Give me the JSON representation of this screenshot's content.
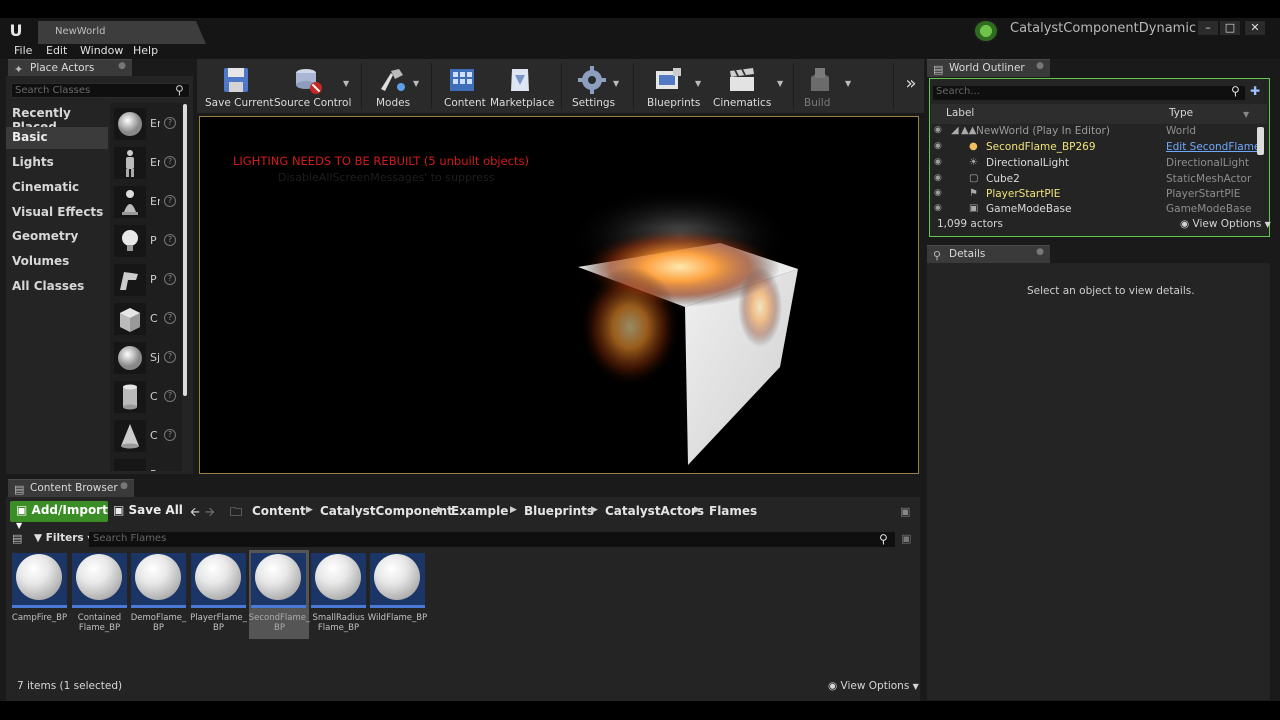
{
  "titlebar": {
    "level_tab": "NewWorld",
    "project_name": "CatalystComponentDynamic",
    "minimize": "–",
    "maximize": "□",
    "close": "✕"
  },
  "menu": [
    "File",
    "Edit",
    "Window",
    "Help"
  ],
  "place_actors": {
    "tab_label": "Place Actors",
    "search_placeholder": "Search Classes",
    "categories": [
      "Recently Placed",
      "Basic",
      "Lights",
      "Cinematic",
      "Visual Effects",
      "Geometry",
      "Volumes",
      "All Classes"
    ],
    "active_category": "Basic",
    "actors": [
      "Er",
      "Er",
      "Er",
      "P",
      "P",
      "C",
      "Sj",
      "C",
      "C",
      "P"
    ]
  },
  "toolbar": {
    "save_current": "Save Current",
    "source_control": "Source Control",
    "modes": "Modes",
    "content": "Content",
    "marketplace": "Marketplace",
    "settings": "Settings",
    "blueprints": "Blueprints",
    "cinematics": "Cinematics",
    "build": "Build",
    "more": "»"
  },
  "viewport": {
    "lighting_warning": "LIGHTING NEEDS TO BE REBUILT (5 unbuilt objects)",
    "suppress_hint": "DisableAllScreenMessages' to suppress"
  },
  "outliner": {
    "tab_label": "World Outliner",
    "search_placeholder": "Search...",
    "col_label": "Label",
    "col_type": "Type",
    "rows": [
      {
        "label": "NewWorld (Play In Editor)",
        "type": "World"
      },
      {
        "label": "SecondFlame_BP269",
        "type": "Edit SecondFlame"
      },
      {
        "label": "DirectionalLight",
        "type": "DirectionalLight"
      },
      {
        "label": "Cube2",
        "type": "StaticMeshActor"
      },
      {
        "label": "PlayerStartPIE",
        "type": "PlayerStartPIE"
      },
      {
        "label": "GameModeBase",
        "type": "GameModeBase"
      }
    ],
    "actor_count": "1,099 actors",
    "view_options": "View Options"
  },
  "details": {
    "tab_label": "Details",
    "empty_message": "Select an object to view details."
  },
  "content_browser": {
    "tab_label": "Content Browser",
    "add_import": "Add/Import",
    "save_all": "Save All",
    "breadcrumb": [
      "Content",
      "CatalystComponent",
      "Example",
      "Blueprints",
      "CatalystActors",
      "Flames"
    ],
    "filters": "Filters",
    "search_placeholder": "Search Flames",
    "assets": [
      {
        "name": "CampFire_BP"
      },
      {
        "name": "Contained Flame_BP"
      },
      {
        "name": "DemoFlame_ BP"
      },
      {
        "name": "PlayerFlame_ BP"
      },
      {
        "name": "SecondFlame_ BP"
      },
      {
        "name": "SmallRadius Flame_BP"
      },
      {
        "name": "WildFlame_BP"
      }
    ],
    "selected_asset": "SecondFlame_ BP",
    "items_count": "7 items (1 selected)",
    "view_options": "View Options"
  },
  "colors": {
    "accent_green": "#3b8d25",
    "outliner_border": "#62c94f",
    "warning_red": "#d11b1b",
    "highlight_yellow": "#f0e27a",
    "link_blue": "#6fa8ff"
  }
}
